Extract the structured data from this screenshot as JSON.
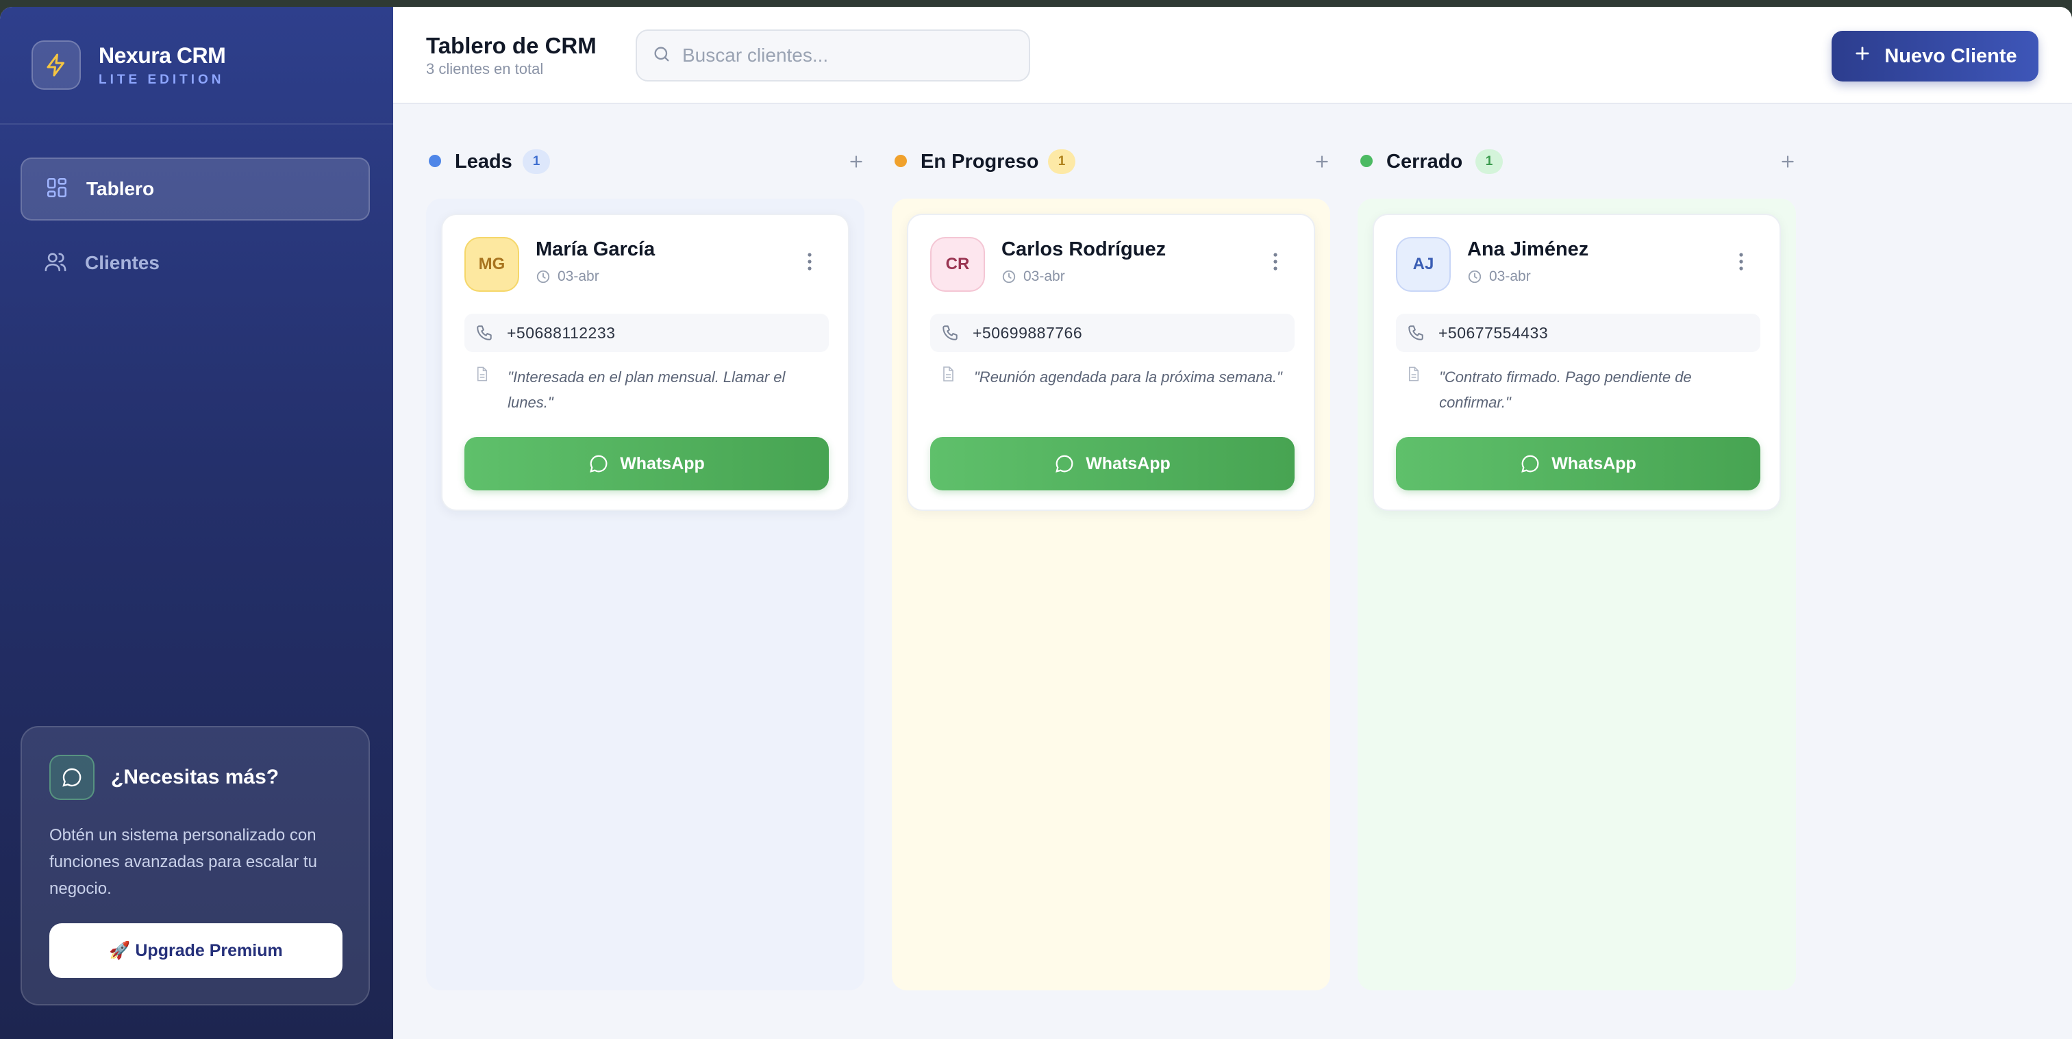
{
  "app": {
    "name": "Nexura CRM",
    "edition": "LITE EDITION"
  },
  "sidebar": {
    "items": [
      {
        "label": "Tablero",
        "icon": "grid-icon",
        "active": true
      },
      {
        "label": "Clientes",
        "icon": "users-icon",
        "active": false
      }
    ],
    "promo": {
      "title": "¿Necesitas más?",
      "description": "Obtén un sistema personalizado con funciones avanzadas para escalar tu negocio.",
      "button_label": "🚀 Upgrade Premium"
    }
  },
  "header": {
    "title": "Tablero de CRM",
    "subtitle": "3 clientes en total",
    "search_placeholder": "Buscar clientes...",
    "search_value": "",
    "new_button_label": "Nuevo Cliente"
  },
  "columns": [
    {
      "title": "Leads",
      "count": "1",
      "dot_color": "#4f86e8",
      "bg_color": "#eef2fb",
      "badge_bg": "#dde7fb",
      "badge_fg": "#3f6fd0",
      "cards": [
        {
          "initials": "MG",
          "name": "María García",
          "date": "03-abr",
          "phone": "+50688112233",
          "note": "\"Interesada en el plan mensual. Llamar el lunes.\"",
          "whatsapp_label": "WhatsApp",
          "avatar_bg": "#fde8a0",
          "avatar_fg": "#a8741f",
          "avatar_border": "#f5d76a"
        }
      ]
    },
    {
      "title": "En Progreso",
      "count": "1",
      "dot_color": "#f0a12c",
      "bg_color": "#fffbea",
      "badge_bg": "#fde9a6",
      "badge_fg": "#b0811b",
      "cards": [
        {
          "initials": "CR",
          "name": "Carlos Rodríguez",
          "date": "03-abr",
          "phone": "+50699887766",
          "note": "\"Reunión agendada para la próxima semana.\"",
          "whatsapp_label": "WhatsApp",
          "avatar_bg": "#fde6ee",
          "avatar_fg": "#9a3552",
          "avatar_border": "#f4c6d4"
        }
      ]
    },
    {
      "title": "Cerrado",
      "count": "1",
      "dot_color": "#4cba63",
      "bg_color": "#effbf1",
      "badge_bg": "#d4f4da",
      "badge_fg": "#3a9a4d",
      "cards": [
        {
          "initials": "AJ",
          "name": "Ana Jiménez",
          "date": "03-abr",
          "phone": "+50677554433",
          "note": "\"Contrato firmado. Pago pendiente de confirmar.\"",
          "whatsapp_label": "WhatsApp",
          "avatar_bg": "#e6eefd",
          "avatar_fg": "#3a5db4",
          "avatar_border": "#c8d6f7"
        }
      ]
    }
  ]
}
